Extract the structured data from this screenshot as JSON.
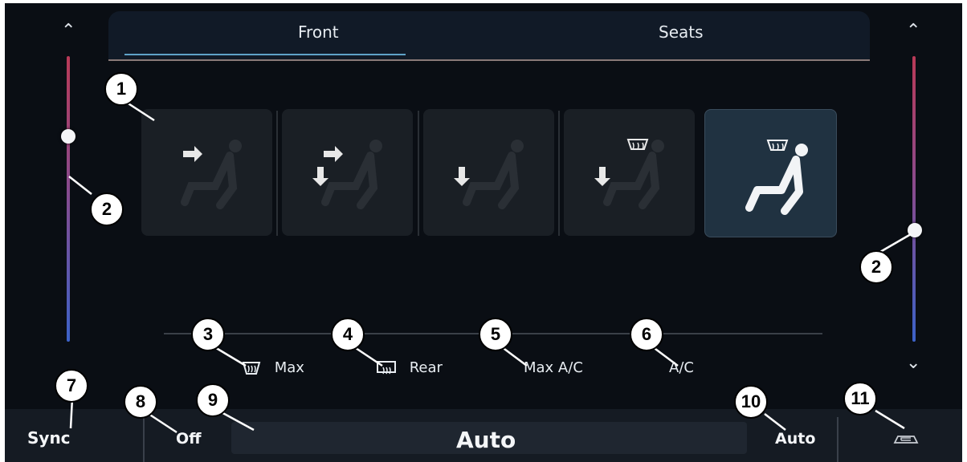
{
  "tabs": [
    {
      "label": "Front",
      "active": true
    },
    {
      "label": "Seats",
      "active": false
    }
  ],
  "air_modes": [
    {
      "name": "face",
      "active": false
    },
    {
      "name": "face-and-feet",
      "active": false
    },
    {
      "name": "feet",
      "active": false
    },
    {
      "name": "feet-and-defrost",
      "active": false
    },
    {
      "name": "defrost-all",
      "active": true
    }
  ],
  "temperature": {
    "left_level": 0.72,
    "right_level": 0.39
  },
  "options": {
    "max_defrost": "Max",
    "rear_defrost": "Rear",
    "max_ac": "Max A/C",
    "ac": "A/C"
  },
  "bottom": {
    "sync": "Sync",
    "off": "Off",
    "fan": "Auto",
    "auto": "Auto"
  },
  "callouts": [
    "1",
    "2",
    "2",
    "3",
    "4",
    "5",
    "6",
    "7",
    "8",
    "9",
    "10",
    "11"
  ],
  "colors": {
    "background": "#0a0e14",
    "tab_accent": "#5fa2c8",
    "active_mode": "#203241",
    "temp_warm": "#b93a57",
    "temp_cool": "#3c62c8"
  }
}
